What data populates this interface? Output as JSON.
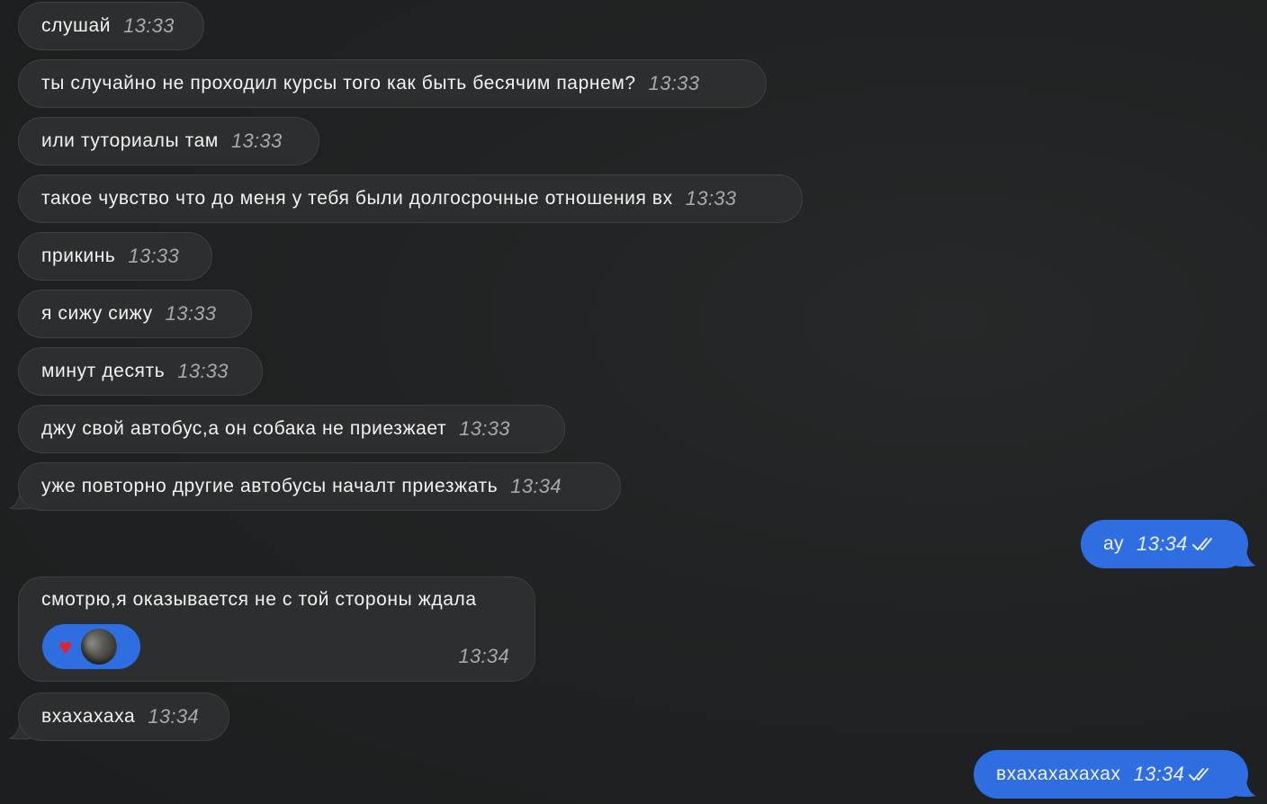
{
  "chat": {
    "messages": [
      {
        "text": "слушай",
        "time": "13:33"
      },
      {
        "text": "ты случайно не проходил курсы того как быть бесячим парнем?",
        "time": "13:33"
      },
      {
        "text": "или туториалы там",
        "time": "13:33"
      },
      {
        "text": "такое чувство что до меня у тебя были долгосрочные отношения вх",
        "time": "13:33"
      },
      {
        "text": "прикинь",
        "time": "13:33"
      },
      {
        "text": "я сижу сижу",
        "time": "13:33"
      },
      {
        "text": "минут десять",
        "time": "13:33"
      },
      {
        "text": "джу свой автобус,а он собака не приезжает",
        "time": "13:33"
      },
      {
        "text": "уже повторно другие автобусы началт приезжать",
        "time": "13:34"
      },
      {
        "text": "ау",
        "time": "13:34"
      },
      {
        "text": "смотрю,я оказывается не с той стороны ждала",
        "time": "13:34",
        "reaction": "heart-emoji"
      },
      {
        "text": "вхахахаха",
        "time": "13:34"
      },
      {
        "text": "вхахахахахах",
        "time": "13:34"
      }
    ]
  },
  "colors": {
    "background": "#202223",
    "incoming_bubble": "#2d2e2f",
    "outgoing_bubble": "#2f6ee0",
    "reaction_heart": "#e0242f"
  },
  "icons": {
    "read_receipt": "double-check-icon"
  }
}
